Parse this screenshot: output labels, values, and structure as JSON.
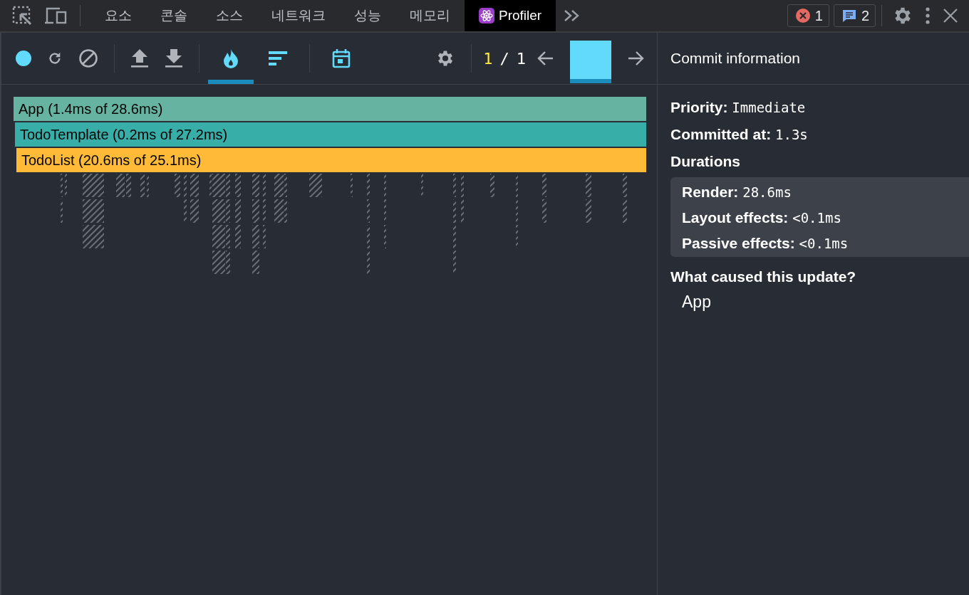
{
  "devtools_tabs": [
    {
      "label": "요소",
      "selected": false
    },
    {
      "label": "콘솔",
      "selected": false
    },
    {
      "label": "소스",
      "selected": false
    },
    {
      "label": "네트워크",
      "selected": false
    },
    {
      "label": "성능",
      "selected": false
    },
    {
      "label": "메모리",
      "selected": false
    },
    {
      "label": "Profiler",
      "selected": true
    }
  ],
  "error_count": "1",
  "message_count": "2",
  "views": [
    {
      "kind": "flame",
      "selected": true
    },
    {
      "kind": "ranked",
      "selected": false
    },
    {
      "kind": "timeline",
      "selected": false
    }
  ],
  "commit_index": "1",
  "commit_separator": "/",
  "commit_total": "1",
  "flame_graph": [
    {
      "label": "App (1.4ms of 28.6ms)",
      "color": "#67b3a1",
      "children": [
        {
          "label": "TodoTemplate (0.2ms of 27.2ms)",
          "color": "#37aea8",
          "children": [
            {
              "label": "TodoList (20.6ms of 25.1ms)",
              "color": "#ffbb38"
            }
          ]
        }
      ]
    }
  ],
  "commit_info": {
    "title": "Commit information",
    "fields": [
      {
        "label": "Priority:",
        "value": "Immediate"
      },
      {
        "label": "Committed at:",
        "value": "1.3s"
      }
    ],
    "durations_title": "Durations",
    "durations": [
      {
        "label": "Render:",
        "value": "28.6ms"
      },
      {
        "label": "Layout effects:",
        "value": "<0.1ms"
      },
      {
        "label": "Passive effects:",
        "value": "<0.1ms"
      }
    ],
    "cause_title": "What caused this update?",
    "causes": [
      "App"
    ]
  }
}
